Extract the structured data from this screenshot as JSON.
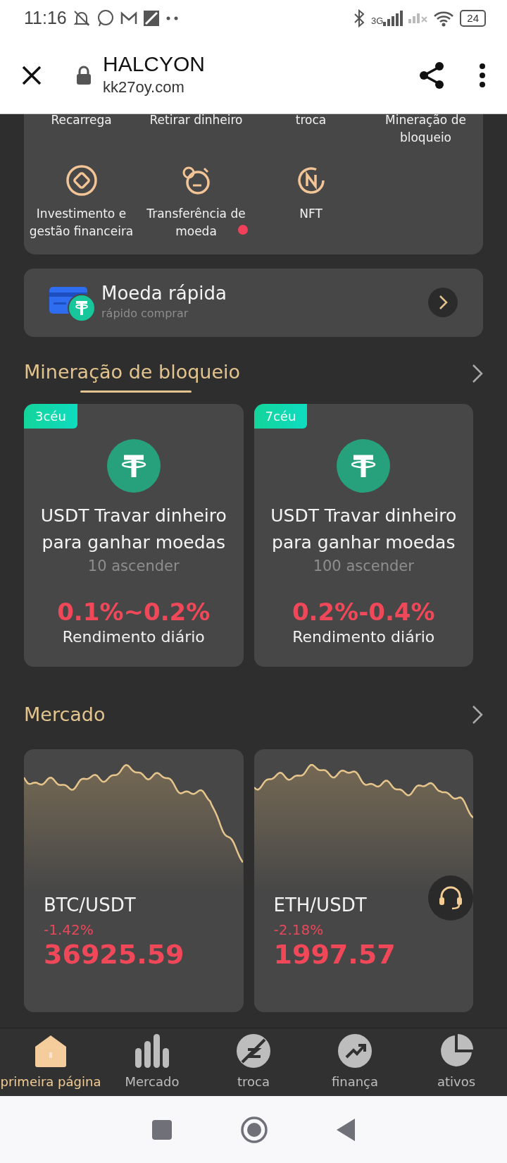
{
  "status_bar": {
    "time": "11:16",
    "network": "3G",
    "battery": "24"
  },
  "browser": {
    "title": "HALCYON",
    "url": "kk27oy.com"
  },
  "menu": [
    {
      "kind": "text",
      "label": "Recarrega",
      "notification": false
    },
    {
      "kind": "text",
      "label": "Retirar dinheiro",
      "notification": false
    },
    {
      "kind": "text",
      "label": "troca",
      "notification": false
    },
    {
      "kind": "text",
      "label": "Mineração de bloqueio",
      "notification": false
    },
    {
      "kind": "icon",
      "label": "Investimento e gestão financeira",
      "notification": false
    },
    {
      "kind": "icon",
      "label": "Transferência de moeda",
      "notification": true
    },
    {
      "kind": "icon",
      "label": "NFT",
      "notification": false
    }
  ],
  "quick": {
    "title": "Moeda rápida",
    "subtitle": "rápido comprar"
  },
  "mining": {
    "title": "Mineração de bloqueio",
    "cards": [
      {
        "tag": "3céu",
        "title": "USDT Travar dinheiro para ganhar moedas",
        "subtitle": "10 ascender",
        "rate": "0.1%~0.2%",
        "rate_label": "Rendimento diário"
      },
      {
        "tag": "7céu",
        "title": "USDT Travar dinheiro para ganhar moedas",
        "subtitle": "100 ascender",
        "rate": "0.2%-0.4%",
        "rate_label": "Rendimento diário"
      }
    ]
  },
  "market": {
    "title": "Mercado",
    "cards": [
      {
        "pair": "BTC/USDT",
        "change": "-1.42%",
        "price": "36925.59"
      },
      {
        "pair": "ETH/USDT",
        "change": "-2.18%",
        "price": "1997.57"
      }
    ]
  },
  "tabs": [
    {
      "label": "primeira página",
      "selected": true
    },
    {
      "label": "Mercado",
      "selected": false
    },
    {
      "label": "troca",
      "selected": false
    },
    {
      "label": "finança",
      "selected": false
    },
    {
      "label": "ativos",
      "selected": false
    }
  ]
}
